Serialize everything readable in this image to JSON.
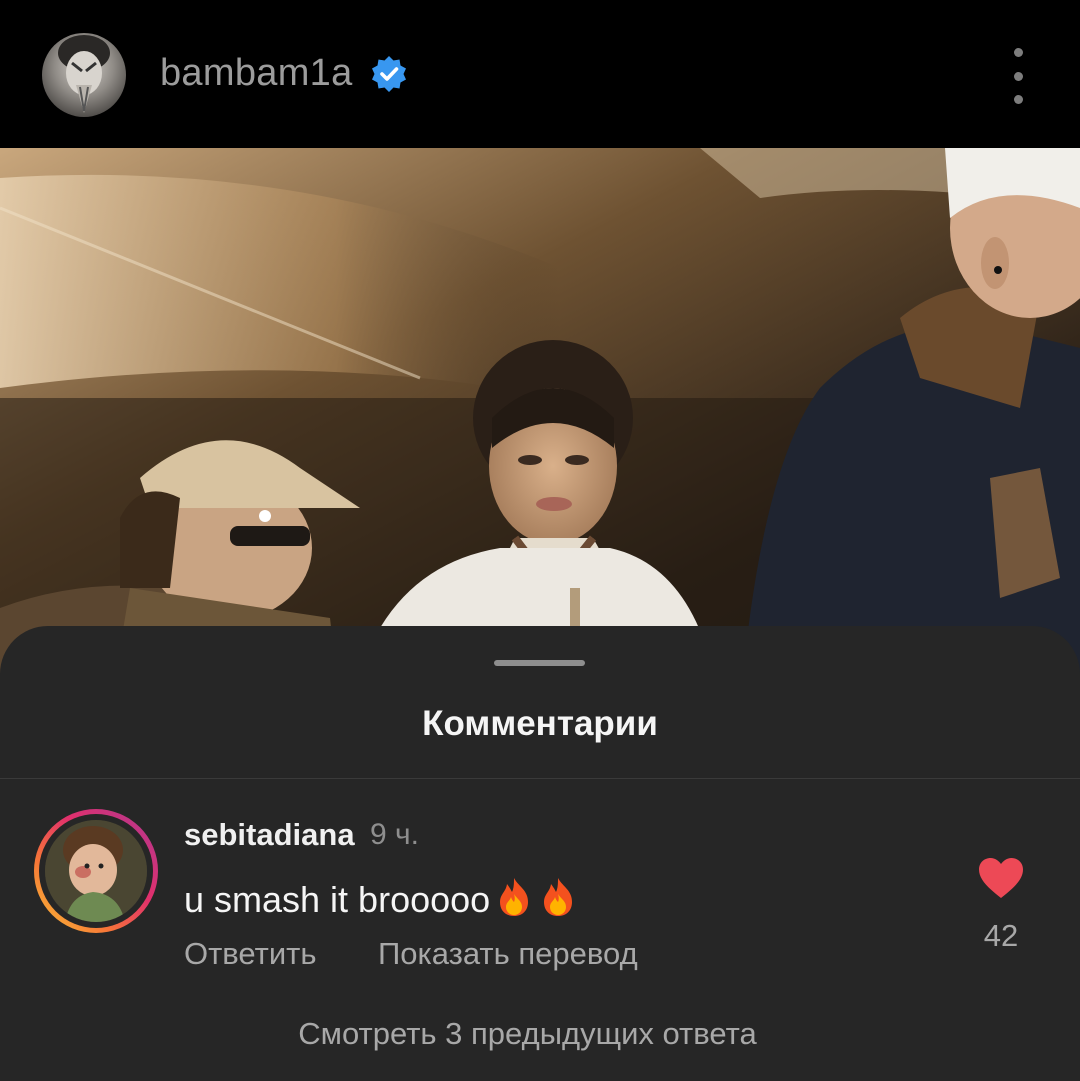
{
  "header": {
    "username": "bambam1a",
    "verified_color": "#3897f0"
  },
  "sheet": {
    "title": "Комментарии"
  },
  "comment": {
    "username": "sebitadiana",
    "time": "9 ч.",
    "text": "u smash it brooooo",
    "emojis": [
      "fire-emoji",
      "fire-emoji"
    ],
    "likes": "42",
    "like_color": "#ed4956",
    "reply_label": "Ответить",
    "translate_label": "Показать перевод",
    "view_replies_label": "Смотреть 3 предыдущих ответа"
  }
}
